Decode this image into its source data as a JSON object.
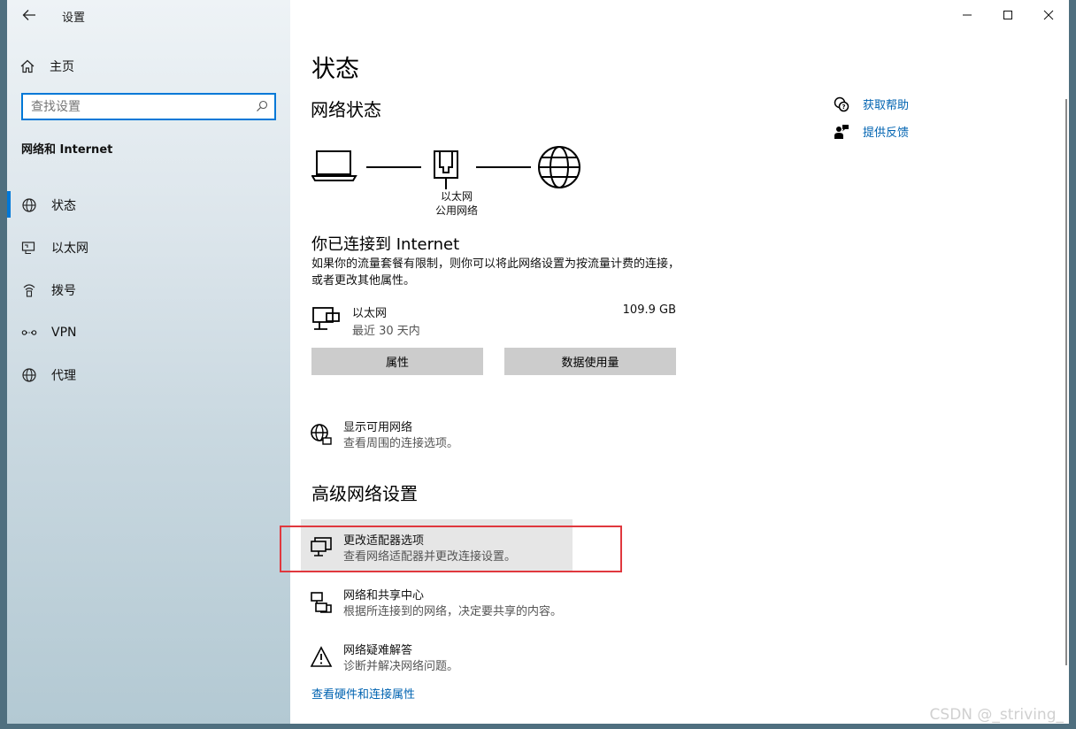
{
  "window": {
    "title": "设置"
  },
  "sidebar": {
    "home_label": "主页",
    "search_placeholder": "查找设置",
    "section_title": "网络和 Internet",
    "items": [
      {
        "label": "状态",
        "icon": "globe-icon",
        "active": true
      },
      {
        "label": "以太网",
        "icon": "ethernet-icon"
      },
      {
        "label": "拨号",
        "icon": "dialup-icon"
      },
      {
        "label": "VPN",
        "icon": "vpn-icon"
      },
      {
        "label": "代理",
        "icon": "globe-icon"
      }
    ]
  },
  "main": {
    "page_title": "状态",
    "network_status_title": "网络状态",
    "diagram": {
      "adapter_name": "以太网",
      "network_type": "公用网络"
    },
    "connected_title": "你已连接到 Internet",
    "connected_desc": "如果你的流量套餐有限制，则你可以将此网络设置为按流量计费的连接，或者更改其他属性。",
    "connection": {
      "name": "以太网",
      "sub": "最近 30 天内",
      "usage": "109.9 GB"
    },
    "buttons": {
      "properties": "属性",
      "data_usage": "数据使用量"
    },
    "show_networks": {
      "title": "显示可用网络",
      "sub": "查看周围的连接选项。"
    },
    "advanced_title": "高级网络设置",
    "advanced": [
      {
        "title": "更改适配器选项",
        "sub": "查看网络适配器并更改连接设置。"
      },
      {
        "title": "网络和共享中心",
        "sub": "根据所连接到的网络，决定要共享的内容。"
      },
      {
        "title": "网络疑难解答",
        "sub": "诊断并解决网络问题。"
      }
    ],
    "hardware_link": "查看硬件和连接属性"
  },
  "help": {
    "get_help": "获取帮助",
    "feedback": "提供反馈"
  },
  "watermark": "CSDN @_striving_",
  "colors": {
    "accent": "#0078d7",
    "link": "#0063b1",
    "highlight_border": "#e0383e"
  }
}
